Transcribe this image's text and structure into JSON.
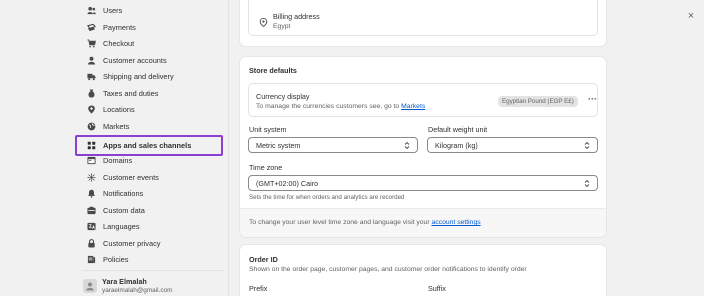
{
  "sidebar": {
    "items": [
      {
        "label": "Users",
        "icon": "users-icon"
      },
      {
        "label": "Payments",
        "icon": "payments-icon"
      },
      {
        "label": "Checkout",
        "icon": "cart-icon"
      },
      {
        "label": "Customer accounts",
        "icon": "person-icon"
      },
      {
        "label": "Shipping and delivery",
        "icon": "truck-icon"
      },
      {
        "label": "Taxes and duties",
        "icon": "taxes-icon"
      },
      {
        "label": "Locations",
        "icon": "location-pin-icon"
      },
      {
        "label": "Markets",
        "icon": "globe-icon"
      },
      {
        "label": "Apps and sales channels",
        "icon": "apps-grid-icon",
        "active": true
      },
      {
        "label": "Domains",
        "icon": "domains-icon"
      },
      {
        "label": "Customer events",
        "icon": "events-icon"
      },
      {
        "label": "Notifications",
        "icon": "bell-icon"
      },
      {
        "label": "Custom data",
        "icon": "custom-data-icon"
      },
      {
        "label": "Languages",
        "icon": "languages-icon"
      },
      {
        "label": "Customer privacy",
        "icon": "lock-icon"
      },
      {
        "label": "Policies",
        "icon": "policies-icon"
      }
    ],
    "profile": {
      "name": "Yara Elmalah",
      "email": "yaraelmalah@gmail.com"
    }
  },
  "billing": {
    "title": "Billing address",
    "value": "Egypt"
  },
  "store_defaults": {
    "title": "Store defaults",
    "currency": {
      "title": "Currency display",
      "desc_prefix": "To manage the currencies customers see, go to ",
      "desc_link": "Markets",
      "badge": "Egyptian Pound (EGP E£)",
      "more": "···"
    },
    "unit_system": {
      "label": "Unit system",
      "value": "Metric system"
    },
    "weight_unit": {
      "label": "Default weight unit",
      "value": "Kilogram (kg)"
    },
    "time_zone": {
      "label": "Time zone",
      "value": "(GMT+02:00) Cairo",
      "help": "Sets the time for when orders and analytics are recorded"
    },
    "footer_prefix": "To change your user level time zone and language visit your ",
    "footer_link": "account settings"
  },
  "order_id": {
    "title": "Order ID",
    "desc": "Shown on the order page, customer pages, and customer order notifications to identify order",
    "prefix_label": "Prefix",
    "suffix_label": "Suffix"
  },
  "close_label": "×",
  "colors": {
    "active_outline": "#8b3fd3",
    "link": "#005bd3"
  }
}
